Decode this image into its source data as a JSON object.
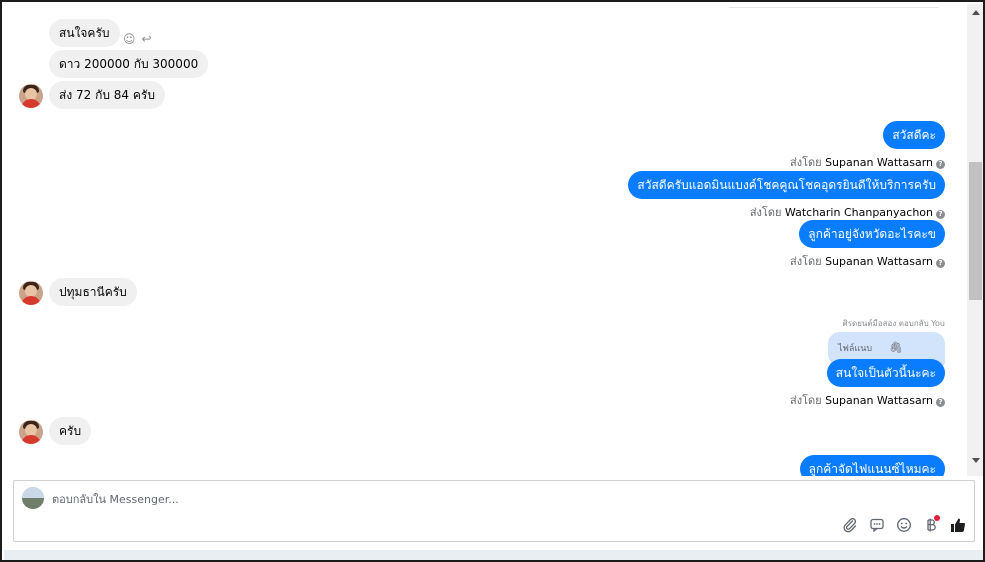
{
  "thread": {
    "incoming": [
      {
        "id": "in1",
        "text": "สนใจครับ"
      },
      {
        "id": "in2",
        "text": "ดาว 200000 กับ 300000"
      },
      {
        "id": "in3",
        "text": "ส่ง 72 กับ 84 ครับ"
      },
      {
        "id": "in4",
        "text": "ปทุมธานีครับ"
      },
      {
        "id": "in5",
        "text": "ครับ"
      }
    ],
    "outgoing": [
      {
        "id": "out1",
        "text": "สวัสดีคะ",
        "sent_by_label": "ส่งโดย",
        "sent_by": "Supanan Wattasarn"
      },
      {
        "id": "out2",
        "text": "สวัสดีครับแอดมินแบงค์โชคคูณโชคอุดรยินดีให้บริการครับ",
        "sent_by_label": "ส่งโดย",
        "sent_by": "Watcharin Chanpanyachon"
      },
      {
        "id": "out3",
        "text": "ลูกค้าอยู่จังหวัดอะไรคะข",
        "sent_by_label": "ส่งโดย",
        "sent_by": "Supanan Wattasarn"
      },
      {
        "id": "out4",
        "text": "สนใจเป็นตัวนี้นะคะ",
        "sent_by_label": "ส่งโดย",
        "sent_by": "Supanan Wattasarn"
      },
      {
        "id": "out5",
        "text": "ลูกค้าจัดไฟแนนซ์ไหมคะ"
      }
    ],
    "reply_meta": "ศิรดยนต์มือสอง ตอบกลับ You",
    "reply_quote_text": "ไฟล์แนบ",
    "info_glyph": "?"
  },
  "composer": {
    "placeholder": "ตอบกลับใน Messenger..."
  },
  "icons": {
    "react": "smile-icon",
    "reply": "reply-icon",
    "attach": "paperclip-icon",
    "sticker": "chat-bubble-icon",
    "emoji": "emoji-icon",
    "payment": "baht-icon",
    "like": "thumbs-up-icon"
  },
  "colors": {
    "outgoing_bubble": "#0a7cff",
    "incoming_bubble": "#f0f0f0",
    "reply_quote": "#d2e3fc",
    "like_icon": "#1c1e21",
    "badge": "#e41e3f"
  }
}
